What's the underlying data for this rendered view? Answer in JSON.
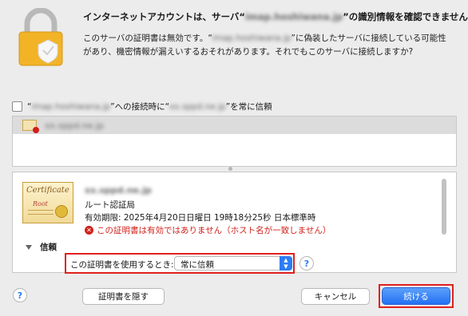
{
  "dialog": {
    "title_prefix": "インターネットアカウントは、サーバ“",
    "server_name": "imap.hoshiwana.jp",
    "title_suffix": "”の識別情報を確認できません。",
    "message_1": "このサーバの証明書は無効です。“",
    "message_2": "”に偽装したサーバに接続している可能性があり、機密情報が漏えいするおそれがあります。それでもこのサーバに接続しますか?"
  },
  "trust_row": {
    "prefix": "“",
    "middle": "”への接続時に“",
    "cert_host": "xx.sppd.ne.jp",
    "suffix": "”を常に信頼"
  },
  "chain": {
    "selected": "xx.sppd.ne.jp"
  },
  "cert": {
    "name": "xx.sppd.ne.jp",
    "issuer": "ルート認証局",
    "expiry": "有効期限: 2025年4月20日日曜日 19時18分25秒 日本標準時",
    "error": "この証明書は有効ではありません（ホスト名が一致しません）",
    "image_script_1": "Certificate",
    "image_script_2": "Root"
  },
  "trust_section": {
    "label": "信頼",
    "policy_label": "この証明書を使用するとき:",
    "policy_value": "常に信頼"
  },
  "buttons": {
    "help": "?",
    "hide": "証明書を隠す",
    "cancel": "キャンセル",
    "continue": "続ける"
  },
  "colors": {
    "accent": "#2e7cf6",
    "error": "#d2221c",
    "highlight_box": "#e0201c"
  }
}
